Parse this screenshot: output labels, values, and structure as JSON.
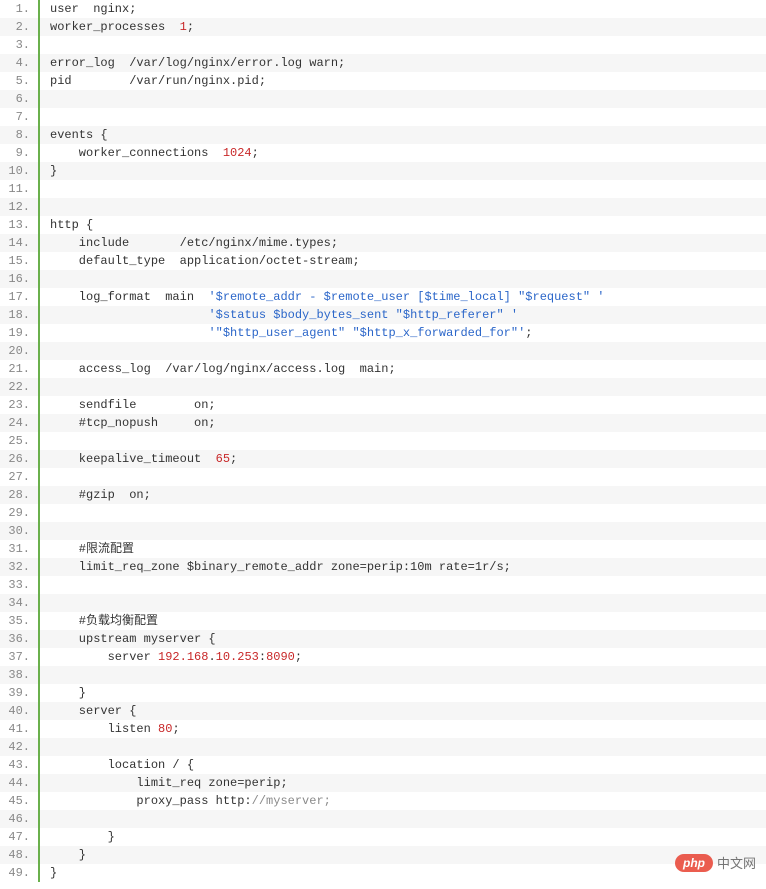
{
  "lines": [
    {
      "n": "1.",
      "segs": [
        {
          "t": "user  nginx;"
        }
      ]
    },
    {
      "n": "2.",
      "segs": [
        {
          "t": "worker_processes  "
        },
        {
          "t": "1",
          "c": "num"
        },
        {
          "t": ";"
        }
      ]
    },
    {
      "n": "3.",
      "segs": []
    },
    {
      "n": "4.",
      "segs": [
        {
          "t": "error_log  /var/log/nginx/error.log warn;"
        }
      ]
    },
    {
      "n": "5.",
      "segs": [
        {
          "t": "pid        /var/run/nginx.pid;"
        }
      ]
    },
    {
      "n": "6.",
      "segs": []
    },
    {
      "n": "7.",
      "segs": []
    },
    {
      "n": "8.",
      "segs": [
        {
          "t": "events {"
        }
      ]
    },
    {
      "n": "9.",
      "segs": [
        {
          "t": "    worker_connections  "
        },
        {
          "t": "1024",
          "c": "num"
        },
        {
          "t": ";"
        }
      ]
    },
    {
      "n": "10.",
      "segs": [
        {
          "t": "}"
        }
      ]
    },
    {
      "n": "11.",
      "segs": []
    },
    {
      "n": "12.",
      "segs": []
    },
    {
      "n": "13.",
      "segs": [
        {
          "t": "http {"
        }
      ]
    },
    {
      "n": "14.",
      "segs": [
        {
          "t": "    include       /etc/nginx/mime.types;"
        }
      ]
    },
    {
      "n": "15.",
      "segs": [
        {
          "t": "    default_type  application/octet-stream;"
        }
      ]
    },
    {
      "n": "16.",
      "segs": []
    },
    {
      "n": "17.",
      "segs": [
        {
          "t": "    log_format  main  "
        },
        {
          "t": "'$remote_addr - $remote_user [$time_local] \"$request\" '",
          "c": "str"
        }
      ]
    },
    {
      "n": "18.",
      "segs": [
        {
          "t": "                      "
        },
        {
          "t": "'$status $body_bytes_sent \"$http_referer\" '",
          "c": "str"
        }
      ]
    },
    {
      "n": "19.",
      "segs": [
        {
          "t": "                      "
        },
        {
          "t": "'\"$http_user_agent\" \"$http_x_forwarded_for\"'",
          "c": "str"
        },
        {
          "t": ";"
        }
      ]
    },
    {
      "n": "20.",
      "segs": []
    },
    {
      "n": "21.",
      "segs": [
        {
          "t": "    access_log  /var/log/nginx/access.log  main;"
        }
      ]
    },
    {
      "n": "22.",
      "segs": []
    },
    {
      "n": "23.",
      "segs": [
        {
          "t": "    sendfile        on;"
        }
      ]
    },
    {
      "n": "24.",
      "segs": [
        {
          "t": "    #tcp_nopush     on;"
        }
      ]
    },
    {
      "n": "25.",
      "segs": []
    },
    {
      "n": "26.",
      "segs": [
        {
          "t": "    keepalive_timeout  "
        },
        {
          "t": "65",
          "c": "num"
        },
        {
          "t": ";"
        }
      ]
    },
    {
      "n": "27.",
      "segs": []
    },
    {
      "n": "28.",
      "segs": [
        {
          "t": "    #gzip  on;"
        }
      ]
    },
    {
      "n": "29.",
      "segs": []
    },
    {
      "n": "30.",
      "segs": []
    },
    {
      "n": "31.",
      "segs": [
        {
          "t": "    #限流配置"
        }
      ]
    },
    {
      "n": "32.",
      "segs": [
        {
          "t": "    limit_req_zone $binary_remote_addr zone=perip:10m rate=1r/s;"
        }
      ]
    },
    {
      "n": "33.",
      "segs": []
    },
    {
      "n": "34.",
      "segs": []
    },
    {
      "n": "35.",
      "segs": [
        {
          "t": "    #负载均衡配置"
        }
      ]
    },
    {
      "n": "36.",
      "segs": [
        {
          "t": "    upstream myserver {"
        }
      ]
    },
    {
      "n": "37.",
      "segs": [
        {
          "t": "        server "
        },
        {
          "t": "192.168",
          "c": "num"
        },
        {
          "t": "."
        },
        {
          "t": "10.253",
          "c": "num"
        },
        {
          "t": ":"
        },
        {
          "t": "8090",
          "c": "num"
        },
        {
          "t": ";"
        }
      ]
    },
    {
      "n": "38.",
      "segs": []
    },
    {
      "n": "39.",
      "segs": [
        {
          "t": "    }"
        }
      ]
    },
    {
      "n": "40.",
      "segs": [
        {
          "t": "    server {"
        }
      ]
    },
    {
      "n": "41.",
      "segs": [
        {
          "t": "        listen "
        },
        {
          "t": "80",
          "c": "num"
        },
        {
          "t": ";"
        }
      ]
    },
    {
      "n": "42.",
      "segs": []
    },
    {
      "n": "43.",
      "segs": [
        {
          "t": "        location / {"
        }
      ]
    },
    {
      "n": "44.",
      "segs": [
        {
          "t": "            limit_req zone=perip;"
        }
      ]
    },
    {
      "n": "45.",
      "segs": [
        {
          "t": "            proxy_pass http:"
        },
        {
          "t": "//myserver;",
          "c": "cmt"
        }
      ]
    },
    {
      "n": "46.",
      "segs": []
    },
    {
      "n": "47.",
      "segs": [
        {
          "t": "        }"
        }
      ]
    },
    {
      "n": "48.",
      "segs": [
        {
          "t": "    }"
        }
      ]
    },
    {
      "n": "49.",
      "segs": [
        {
          "t": "}"
        }
      ]
    }
  ],
  "watermark": {
    "badge": "php",
    "text": "中文网"
  }
}
